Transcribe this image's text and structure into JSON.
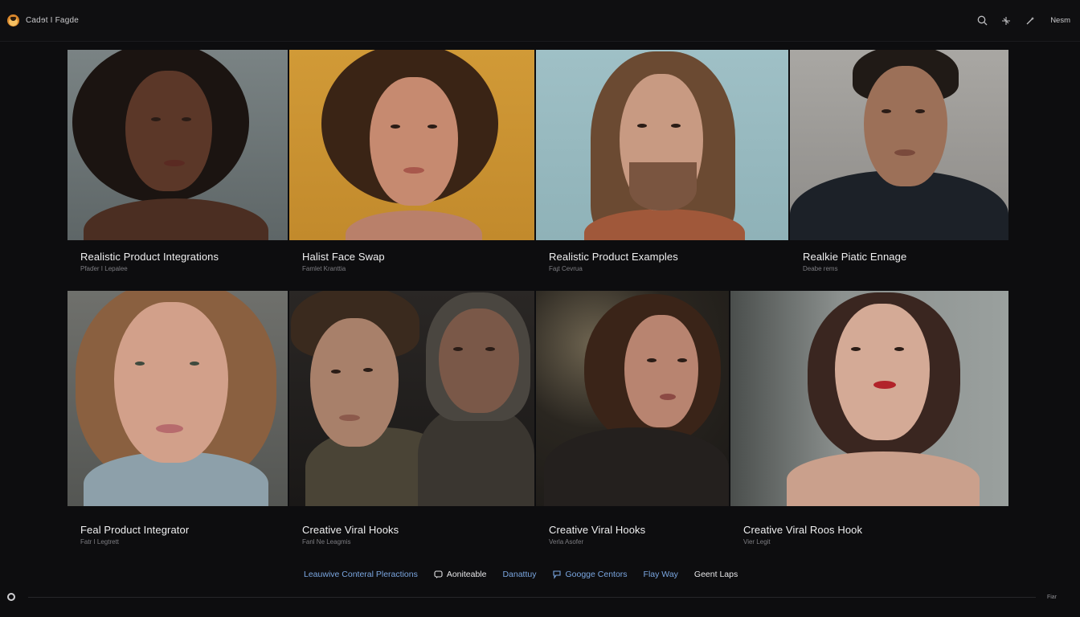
{
  "app": {
    "brand_name": "Cadɘt I Fagde",
    "user_label": "Nesm"
  },
  "icons": {
    "logo": "app-logo-icon",
    "search": "search-icon",
    "tool_a": "sparkle-icon",
    "tool_b": "wand-icon"
  },
  "gallery": {
    "row1": [
      {
        "title": "Realistic Product Integrations",
        "subtitle": "Pfaɗer I Lepalee"
      },
      {
        "title": "Halist Face Swap",
        "subtitle": "Famlet Kranttia"
      },
      {
        "title": "Realistic Product Examples",
        "subtitle": "Faɟt Cevrua"
      },
      {
        "title": "Realkie Piatic Ennage",
        "subtitle": "Deabe rems"
      }
    ],
    "row2": [
      {
        "title": "Feal Product Integrator",
        "subtitle": "Fatr I Legtrett"
      },
      {
        "title": "Creative Viral Hooks",
        "subtitle": "Fanl Ne Leagmis"
      },
      {
        "title": "Creative Viral Hooks",
        "subtitle": "Verla Asofer"
      },
      {
        "title": "Creative Viral Roos Hook",
        "subtitle": "Vier Legit"
      }
    ]
  },
  "footer": {
    "links": [
      {
        "label": "Leauwive Conteral Pleractions"
      },
      {
        "label": "Aoniteable"
      },
      {
        "label": "Danattuy"
      },
      {
        "label": "Googge Centors"
      },
      {
        "label": "Flay Way"
      },
      {
        "label": "Geent Laps"
      }
    ],
    "scrub_label": "Fiar"
  },
  "colors": {
    "background": "#0d0d0f",
    "link": "#7aa6e0",
    "text": "#f0f0f1"
  }
}
